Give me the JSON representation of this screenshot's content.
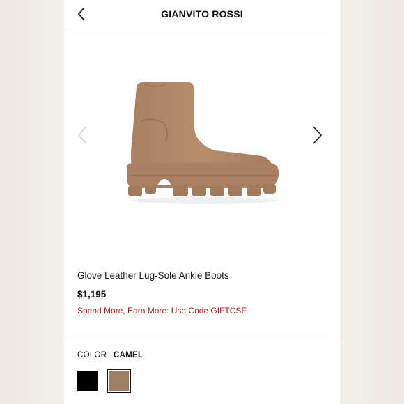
{
  "header": {
    "brand": "GIANVITO ROSSI",
    "back_icon": "chevron-left-icon"
  },
  "gallery": {
    "image_alt": "boot-image",
    "prev_icon": "chevron-left-icon",
    "next_icon": "chevron-right-icon",
    "boot_color": "#b2896a"
  },
  "product": {
    "name": "Glove Leather Lug-Sole Ankle Boots",
    "price": "$1,195",
    "promo": "Spend More, Earn More: Use Code GIFTCSF",
    "promo_color": "#9b1b1b"
  },
  "color": {
    "label": "COLOR",
    "selected": "CAMEL",
    "swatches": [
      {
        "name": "black",
        "hex": "#000000"
      },
      {
        "name": "camel",
        "hex": "#9f7f63"
      }
    ]
  }
}
